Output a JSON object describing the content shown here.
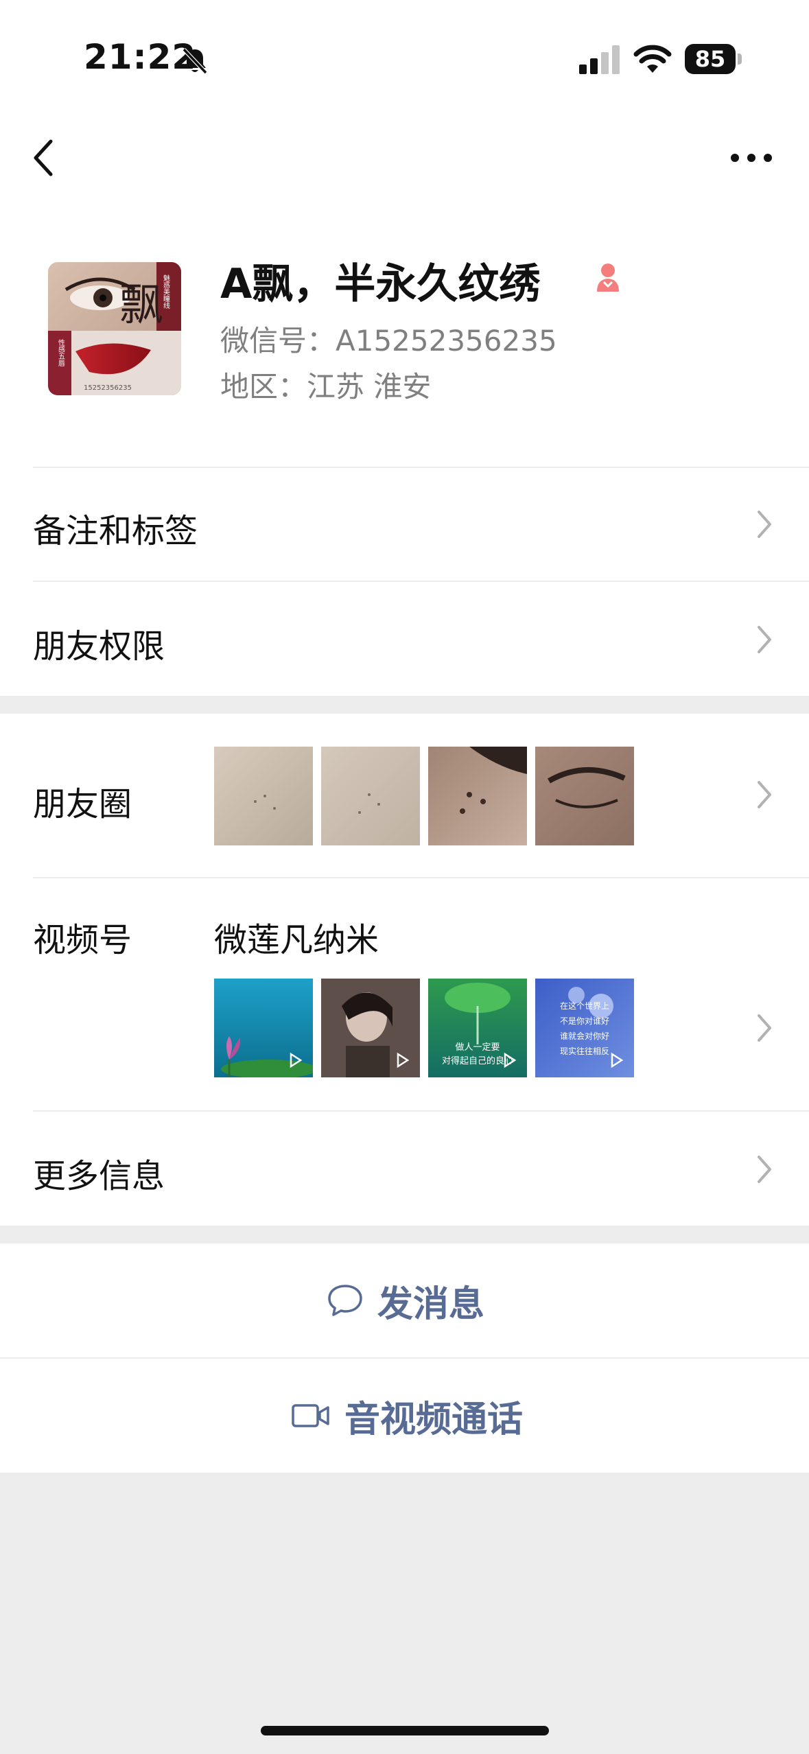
{
  "status_bar": {
    "time": "21:22",
    "battery": "85"
  },
  "profile": {
    "name": "A飘，半永久纹绣",
    "wechat_id": "微信号：A15252356235",
    "region": "地区：江苏 淮安",
    "avatar_char": "飘",
    "avatar_text_top": "魅惑美瞳线",
    "avatar_text_bottom": "性感五唇",
    "avatar_phone": "15252356235"
  },
  "menu": {
    "remarks_tags": "备注和标签",
    "friend_permissions": "朋友权限",
    "moments": "朋友圈",
    "channels": "视频号",
    "channel_name": "微莲凡纳米",
    "more_info": "更多信息"
  },
  "channel_thumbs": {
    "t3_line1": "做人一定要",
    "t3_line2": "对得起自己的良心",
    "t4_line1": "在这个世界上",
    "t4_line2": "不是你对谁好",
    "t4_line3": "谁就会对你好",
    "t4_line4": "现实往往相反"
  },
  "actions": {
    "send_message": "发消息",
    "av_call": "音视频通话"
  },
  "colors": {
    "link": "#576b95",
    "gender_female": "#f37e7d",
    "background": "#ededed"
  }
}
